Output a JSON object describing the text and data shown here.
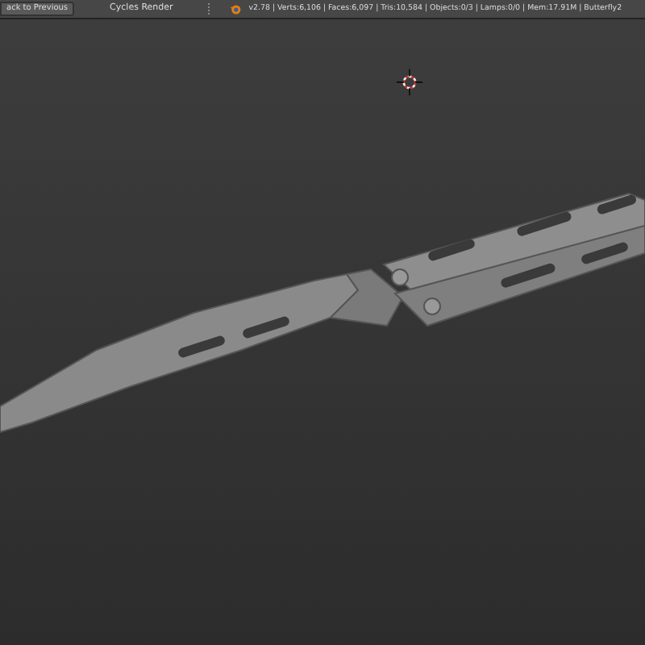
{
  "header": {
    "back_button": "ack to Previous",
    "render_engine": "Cycles Render",
    "stats": "v2.78 | Verts:6,106 | Faces:6,097 | Tris:10,584 | Objects:0/3 | Lamps:0/0 | Mem:17.91M | Butterfly2"
  }
}
